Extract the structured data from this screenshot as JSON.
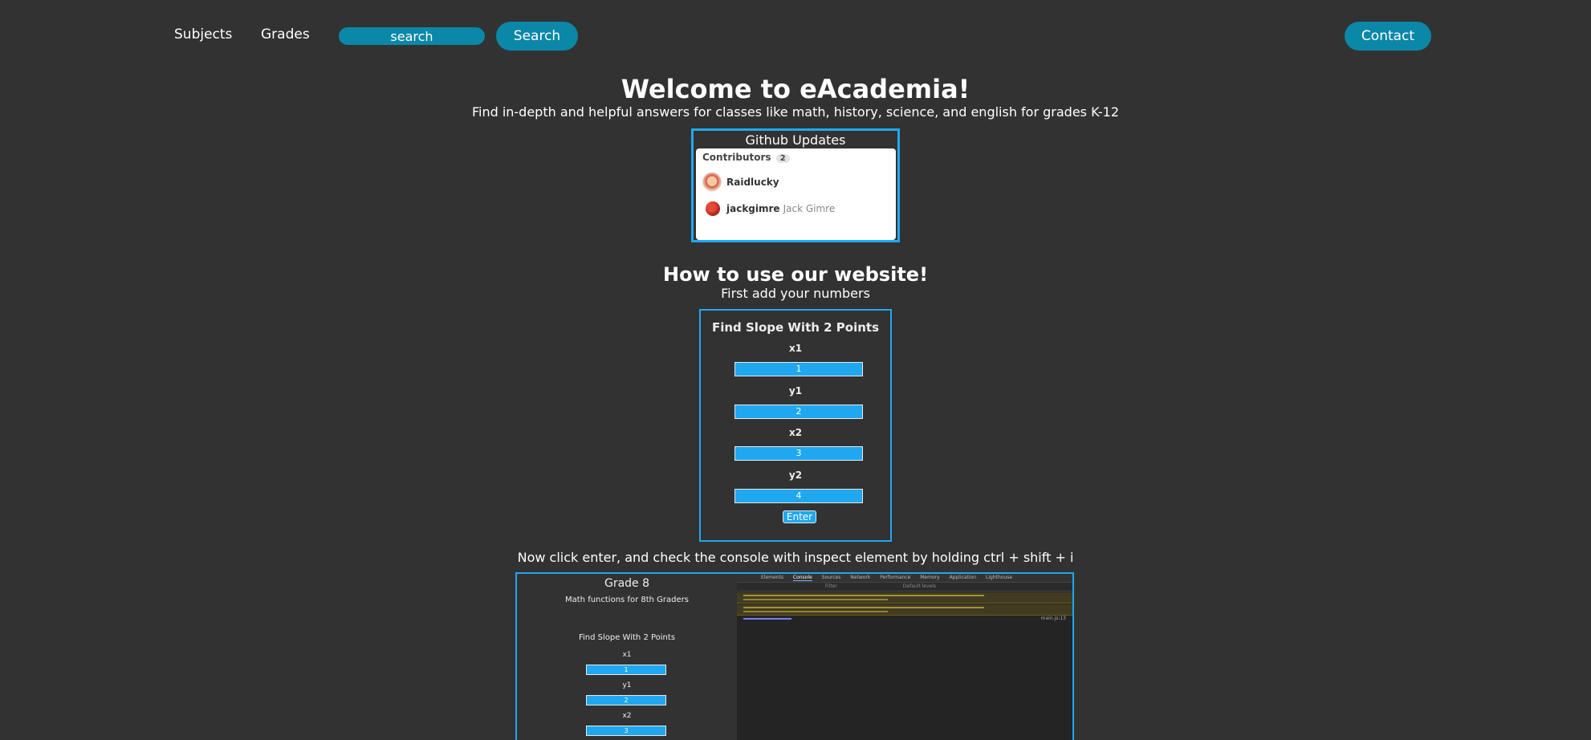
{
  "nav": {
    "subjects": "Subjects",
    "grades": "Grades",
    "search_placeholder": "search",
    "search_button": "Search",
    "contact_button": "Contact"
  },
  "hero": {
    "title": "Welcome to eAcademia!",
    "subtitle": "Find in-depth and helpful answers for classes like math, history, science, and english for grades K-12"
  },
  "github": {
    "title": "Github Updates",
    "contributors_label": "Contributors",
    "contributors_count": "2",
    "contributors": [
      {
        "username": "Raidlucky",
        "fullname": ""
      },
      {
        "username": "jackgimre",
        "fullname": "Jack Gimre"
      }
    ]
  },
  "howto": {
    "title": "How to use our website!",
    "step1": "First add your numbers",
    "step2": "Now click enter, and check the console with inspect element by holding ctrl + shift + i"
  },
  "slope_form": {
    "title": "Find Slope With 2 Points",
    "fields": [
      {
        "label": "x1",
        "value": "1"
      },
      {
        "label": "y1",
        "value": "2"
      },
      {
        "label": "x2",
        "value": "3"
      },
      {
        "label": "y2",
        "value": "4"
      }
    ],
    "enter": "Enter"
  },
  "screenshot": {
    "grade_title": "Grade 8",
    "grade_subtitle": "Math functions for 8th Graders",
    "form_title": "Find Slope With 2 Points",
    "fields": [
      {
        "label": "x1",
        "value": "1"
      },
      {
        "label": "y1",
        "value": "2"
      },
      {
        "label": "x2",
        "value": "3"
      }
    ],
    "devtools_tabs": [
      "Elements",
      "Console",
      "Sources",
      "Network",
      "Performance",
      "Memory",
      "Application",
      "Lighthouse"
    ],
    "filter_placeholder": "Filter",
    "levels": "Default levels",
    "source_link": "main.js:13"
  },
  "colors": {
    "background": "#323232",
    "accent_teal": "#0b87a8",
    "accent_blue": "#1fa8f0"
  }
}
